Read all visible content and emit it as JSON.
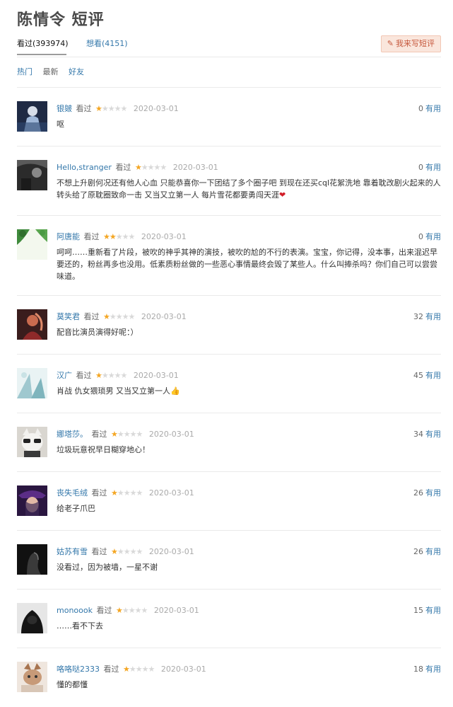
{
  "page": {
    "title": "陈情令 短评"
  },
  "tabs": {
    "watched": "看过(393974)",
    "wish": "想看(4151)",
    "write_button": "我来写短评"
  },
  "sorts": [
    "热门",
    "最新",
    "好友"
  ],
  "useful_label": "有用",
  "comments": [
    {
      "user": "银皴",
      "status": "看过",
      "rating": 1,
      "date": "2020-03-01",
      "votes": "0",
      "text": "呕"
    },
    {
      "user": "Hello,stranger",
      "status": "看过",
      "rating": 1,
      "date": "2020-03-01",
      "votes": "0",
      "text": "不想上升剧何况还有他人心血 只能恭喜你一下团结了多个圈子吧 到现在还买cql花絮洗地 靠着耽改剧火起来的人 转头给了原耽圈致命一击 又当又立第一人 每片雪花都要勇闯天涯"
    },
    {
      "user": "阿唐能",
      "status": "看过",
      "rating": 2,
      "date": "2020-03-01",
      "votes": "0",
      "text": "呵呵……重新看了片段，被吹的神乎其神的演技，被吹的尬的不行的表演。宝宝，你记得，没本事，出来混迟早要还的，粉丝再多也没用。低素质粉丝做的一些恶心事情最终会毁了某些人。什么叫捧杀吗？你们自己可以尝尝味道。"
    },
    {
      "user": "莫笑君",
      "status": "看过",
      "rating": 1,
      "date": "2020-03-01",
      "votes": "32",
      "text": "配音比演员演得好呢：）"
    },
    {
      "user": "汉广",
      "status": "看过",
      "rating": 1,
      "date": "2020-03-01",
      "votes": "45",
      "text": "肖战 仇女猥琐男 又当又立第一人"
    },
    {
      "user": "娜塔莎。",
      "status": "看过",
      "rating": 1,
      "date": "2020-03-01",
      "votes": "34",
      "text": "垃圾玩意祝早日糊穿地心！"
    },
    {
      "user": "丧失毛绒",
      "status": "看过",
      "rating": 1,
      "date": "2020-03-01",
      "votes": "26",
      "text": "给老子爪巴"
    },
    {
      "user": "姑苏有雪",
      "status": "看过",
      "rating": 1,
      "date": "2020-03-01",
      "votes": "26",
      "text": "没看过，因为被墙，一星不谢"
    },
    {
      "user": "monoook",
      "status": "看过",
      "rating": 1,
      "date": "2020-03-01",
      "votes": "15",
      "text": "……看不下去"
    },
    {
      "user": "咯咯哒2333",
      "status": "看过",
      "rating": 1,
      "date": "2020-03-01",
      "votes": "18",
      "text": "懂的都懂"
    }
  ],
  "colors": {
    "link": "#3377aa",
    "star": "#f4a623",
    "heart": "#d21f2a",
    "write_bg": "#fae6dc"
  }
}
